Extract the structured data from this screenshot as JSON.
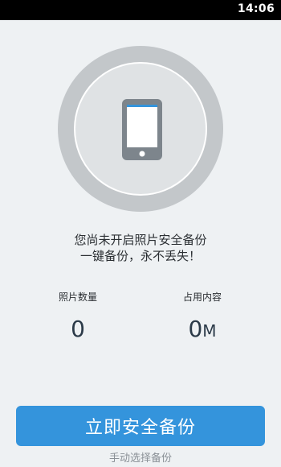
{
  "status_bar": {
    "time": "14:06"
  },
  "hero": {
    "icon": "smartphone-icon"
  },
  "message": {
    "line1": "您尚未开启照片安全备份",
    "line2": "一键备份，永不丢失！"
  },
  "stats": {
    "photo_count": {
      "label": "照片数量",
      "value": "0"
    },
    "storage_used": {
      "label": "占用内容",
      "value": "0",
      "unit": "M"
    }
  },
  "actions": {
    "backup_now_label": "立即安全备份",
    "manual_select_label": "手动选择备份"
  },
  "colors": {
    "accent": "#3494dc",
    "background": "#eef1f3",
    "ring": "#c3c7ca"
  }
}
